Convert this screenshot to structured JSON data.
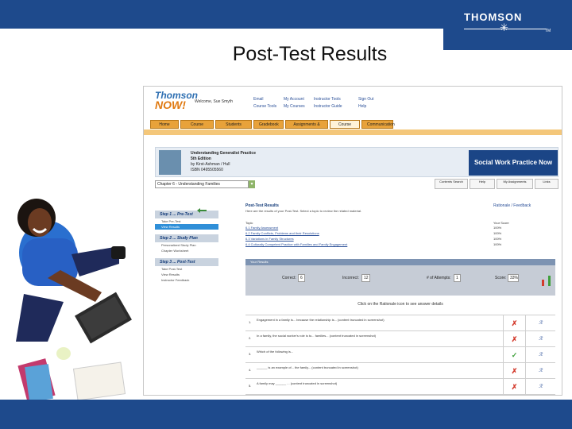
{
  "brand": {
    "name": "THOMSON",
    "tm": "TM"
  },
  "slide": {
    "title": "Post-Test Results"
  },
  "app": {
    "logo_line1": "Thomson",
    "logo_line2": "NOW!",
    "welcome": "Welcome, Sue Smyth",
    "header_links": [
      [
        "Email",
        "Course Tools"
      ],
      [
        "My Account",
        "My Courses"
      ],
      [
        "Instructor Tools",
        "Instructor Guide"
      ],
      [
        "Sign Out",
        "Help"
      ]
    ],
    "tabs": [
      "Home",
      "Course",
      "Students",
      "Gradebook",
      "Assignments & Tests",
      "Course Materials",
      "Communication"
    ],
    "active_tab": "Course Materials",
    "course_title_lines": [
      "Understanding Generalist Practice",
      "5th Edition",
      "by Kirst-Ashman / Hull",
      "ISBN 0495505560"
    ],
    "swp_label": "Social Work Practice Now",
    "chapter_select": "Chapter 6 - Understanding Families",
    "chapter_buttons": [
      "Contents Search",
      "Help",
      "My Assignments",
      "Links"
    ],
    "nav": {
      "step1": "Step 1 ... Pre-Test",
      "step1_items": [
        "Take Pre-Test",
        "View Results"
      ],
      "step2": "Step 2 ... Study Plan",
      "step2_items": [
        "Personalized Study Plan",
        "Chapter Worksheet"
      ],
      "step3": "Step 3 ... Post-Test",
      "step3_items": [
        "Take Post-Test",
        "View Results",
        "Instructor Feedback"
      ]
    },
    "content": {
      "title": "Post-Test Results",
      "description": "Here are the results of your Post-Test. Select a topic to review the related material.",
      "explanation_link": "Rationale / Feedback",
      "topic_header": "Topic",
      "score_header": "Your Score",
      "topics": [
        "6.1 Family Assessment",
        "6.2 Family Conflicts, Problems and their Resolutions",
        "6.3 Variations in Family Structures",
        "6.4 Culturally Competent Practice with Families and Family Engagement"
      ],
      "scores": [
        "100%",
        "100%",
        "100%",
        "100%"
      ]
    },
    "results": {
      "header": "Your Results",
      "correct_label": "Correct:",
      "correct_value": "6",
      "incorrect_label": "Incorrect:",
      "incorrect_value": "12",
      "attempts_label": "# of Attempts:",
      "attempts_value": "1",
      "score_label": "Score:",
      "score_value": "33%"
    },
    "question_note": "Click on the Rationale icon to see answer details",
    "questions": [
      {
        "num": "1.",
        "text": "Engagement in a family is... because the relationship is... (content truncated in screenshot)",
        "mark": "✗",
        "correct": false
      },
      {
        "num": "2.",
        "text": "In a family, the social worker's role is to... families... (content truncated in screenshot)",
        "mark": "✗",
        "correct": false
      },
      {
        "num": "3.",
        "text": "Which of the following is...",
        "mark": "✓",
        "correct": true
      },
      {
        "num": "4.",
        "text": "______ is an example of... the family... (content truncated in screenshot)",
        "mark": "✗",
        "correct": false
      },
      {
        "num": "5.",
        "text": "A family may ______ ... (content truncated in screenshot)",
        "mark": "✗",
        "correct": false
      }
    ],
    "rationale_icon": "ℛ"
  }
}
